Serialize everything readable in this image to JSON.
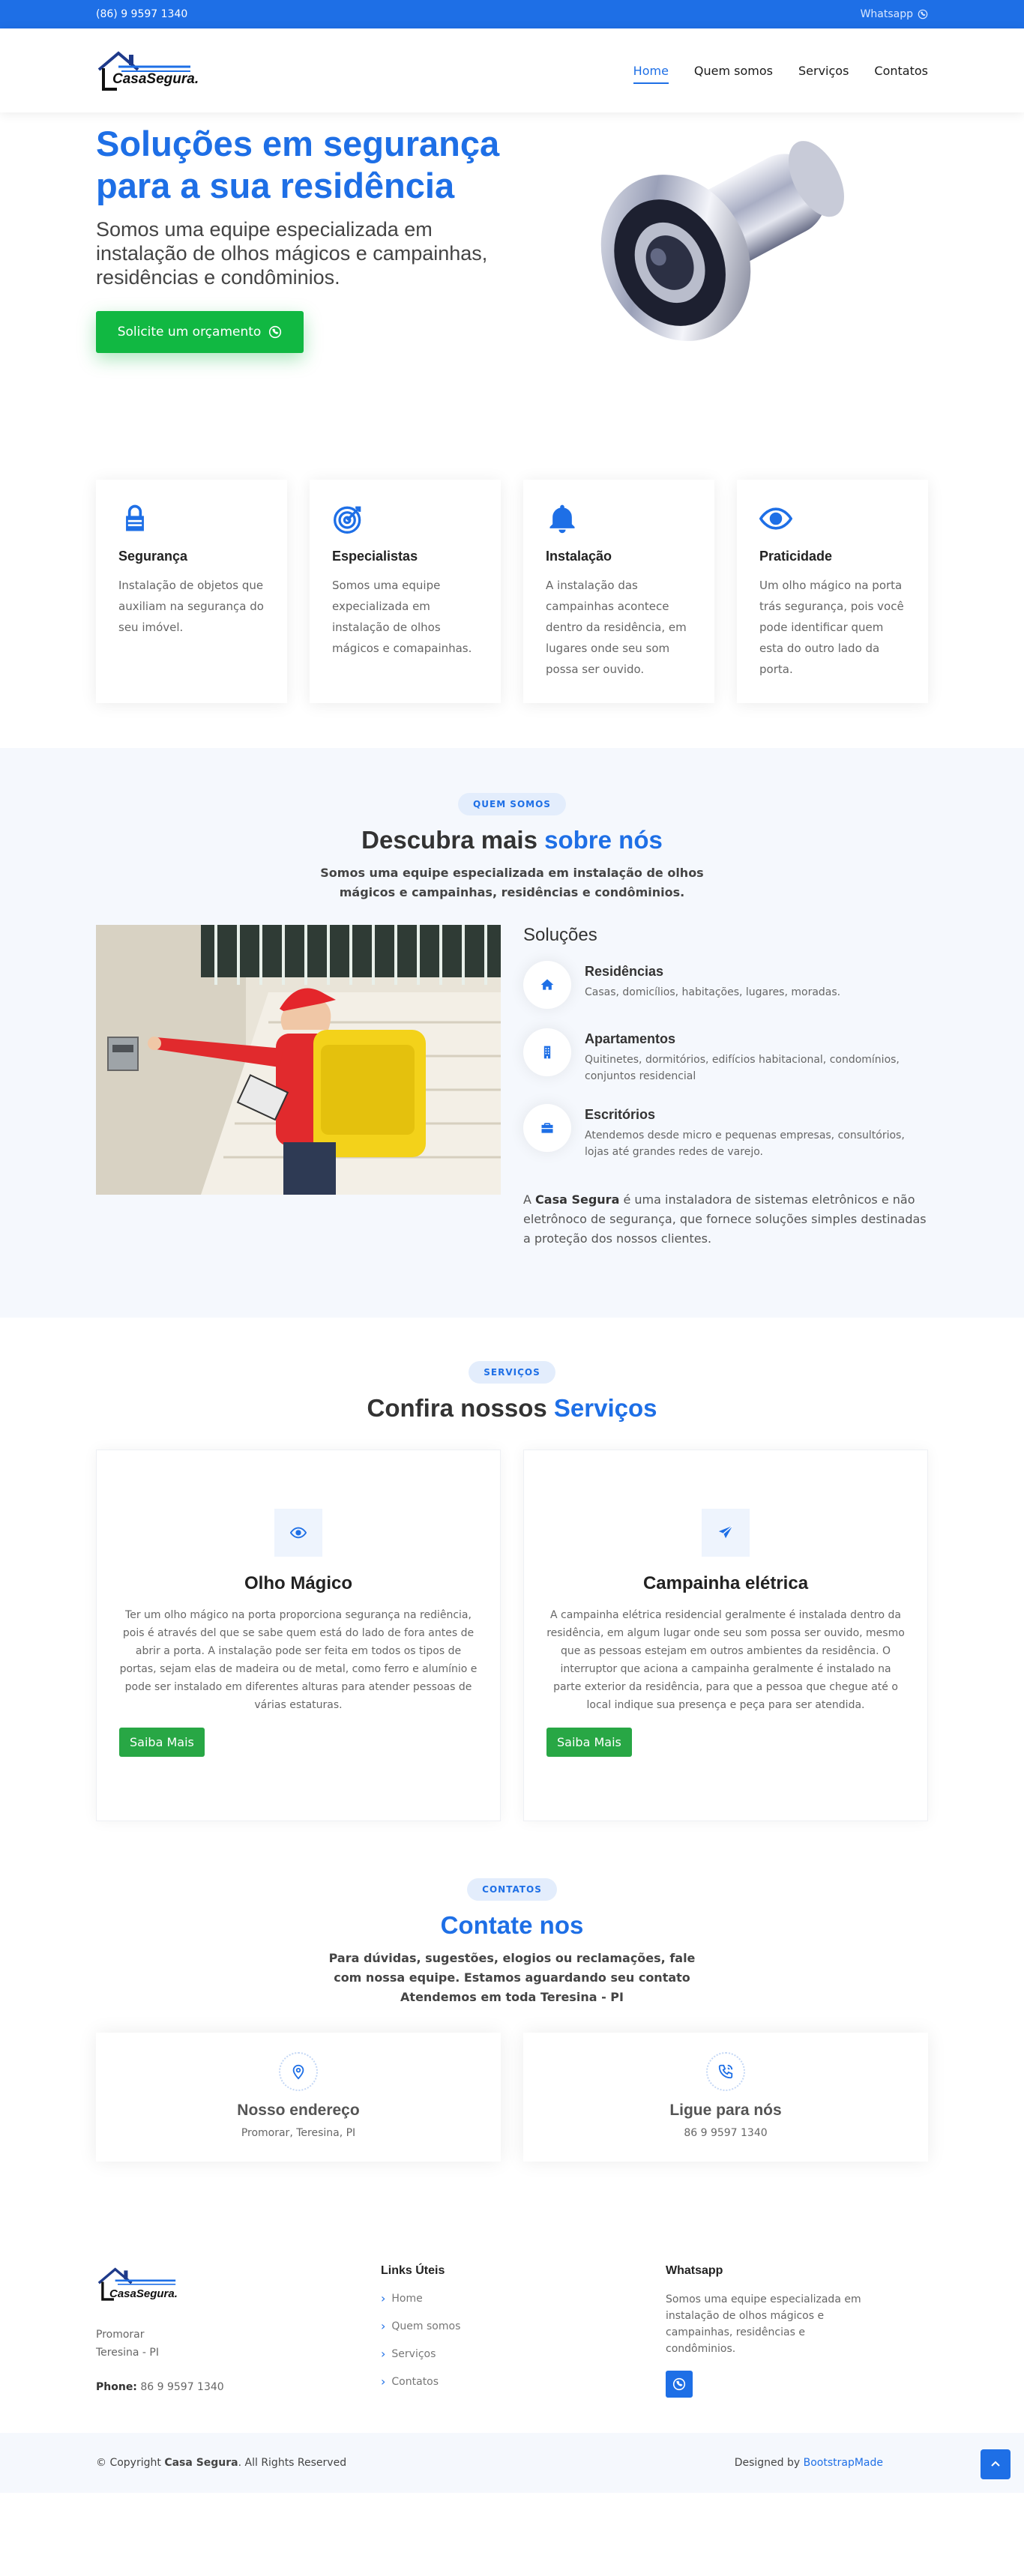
{
  "topbar": {
    "phone": "(86) 9 9597 1340",
    "whatsapp": "Whatsapp"
  },
  "header": {
    "logo": "CasaSegura.",
    "nav": [
      "Home",
      "Quem somos",
      "Serviços",
      "Contatos"
    ]
  },
  "hero": {
    "title": "Soluções em segurança para a sua residência",
    "subtitle": "Somos uma equipe especializada em instalação de olhos mágicos e campainhas, residências e condôminios.",
    "cta": "Solicite um orçamento"
  },
  "features": [
    {
      "icon": "lock-icon",
      "title": "Segurança",
      "text": "Instalação de objetos que auxiliam na segurança do seu imóvel."
    },
    {
      "icon": "target-icon",
      "title": "Especialistas",
      "text": "Somos uma equipe expecializada em instalação de olhos mágicos e comapainhas."
    },
    {
      "icon": "bell-icon",
      "title": "Instalação",
      "text": "A instalação das campainhas acontece dentro da residência, em lugares onde seu som possa ser ouvido."
    },
    {
      "icon": "eye-icon",
      "title": "Praticidade",
      "text": "Um olho mágico na porta trás segurança, pois você pode identificar quem esta do outro lado da porta."
    }
  ],
  "about": {
    "badge": "QUEM SOMOS",
    "title_plain": "Descubra mais",
    "title_highlight": "sobre nós",
    "lead": "Somos uma equipe especializada em instalação de olhos mágicos e campainhas, residências e condôminios.",
    "solutions_title": "Soluções",
    "solutions": [
      {
        "icon": "home-icon",
        "title": "Residências",
        "text": "Casas, domicílios, habitações, lugares, moradas."
      },
      {
        "icon": "building-icon",
        "title": "Apartamentos",
        "text": "Quitinetes, dormitórios, edifícios habitacional, condomínios, conjuntos residencial"
      },
      {
        "icon": "briefcase-icon",
        "title": "Escritórios",
        "text": "Atendemos desde micro e pequenas empresas, consultórios, lojas até grandes redes de varejo."
      }
    ],
    "text_prefix": "A ",
    "text_bold": "Casa Segura",
    "text_suffix": " é uma instaladora de sistemas eletrônicos e não eletrônoco de segurança, que fornece soluções simples destinadas a proteção dos nossos clientes."
  },
  "services": {
    "badge": "SERVIÇOS",
    "title_plain": "Confira nossos",
    "title_highlight": "Serviços",
    "items": [
      {
        "icon": "eye-icon",
        "title": "Olho Mágico",
        "text": "Ter um olho mágico na porta proporciona segurança na rediência, pois é através del que se sabe quem está do lado de fora antes de abrir a porta. A instalação pode ser feita em todos os tipos de portas, sejam elas de madeira ou de metal, como ferro e alumínio e pode ser instalado em diferentes alturas para atender pessoas de várias estaturas.",
        "button": "Saiba Mais"
      },
      {
        "icon": "send-icon",
        "title": "Campainha elétrica",
        "text": "A campainha elétrica residencial geralmente é instalada dentro da residência, em algum lugar onde seu som possa ser ouvido, mesmo que as pessoas estejam em outros ambientes da residência. O interruptor que aciona a campainha geralmente é instalado na parte exterior da residência, para que a pessoa que chegue até o local indique sua presença e peça para ser atendida.",
        "button": "Saiba Mais"
      }
    ]
  },
  "contact": {
    "badge": "CONTATOS",
    "title": "Contate nos",
    "lead": "Para dúvidas, sugestões, elogios ou reclamações, fale com nossa equipe. Estamos aguardando seu contato",
    "lead2": "Atendemos em toda Teresina - PI",
    "cards": [
      {
        "icon": "map-pin-icon",
        "title": "Nosso endereço",
        "text": "Promorar, Teresina, PI"
      },
      {
        "icon": "phone-icon",
        "title": "Ligue para nós",
        "text": "86 9 9597 1340"
      }
    ]
  },
  "footer": {
    "logo": "CasaSegura.",
    "address1": "Promorar",
    "address2": "Teresina - PI",
    "phone_label": "Phone:",
    "phone": "86 9 9597 1340",
    "links_title": "Links Úteis",
    "links": [
      "Home",
      "Quem somos",
      "Serviços",
      "Contatos"
    ],
    "wa_title": "Whatsapp",
    "wa_text": "Somos uma equipe especializada em instalação de olhos mágicos e campainhas, residências e condôminios."
  },
  "copyright": {
    "prefix": "© Copyright ",
    "brand": "Casa Segura",
    "suffix": ". All Rights Reserved",
    "designed_by": "Designed by ",
    "designer": "BootstrapMade"
  },
  "colors": {
    "primary": "#1e6fe6",
    "cta": "#11b842",
    "button": "#28a745",
    "soft_bg": "#f5f8fd"
  }
}
